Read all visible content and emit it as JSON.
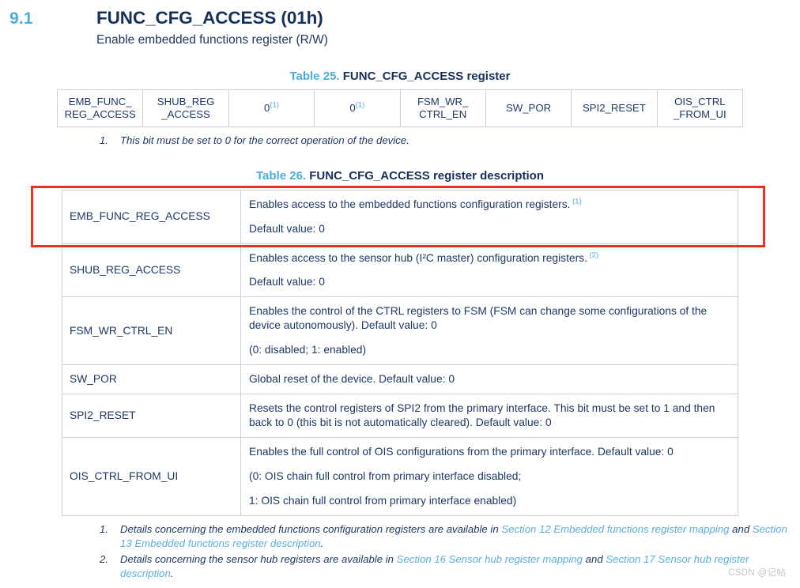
{
  "header": {
    "section_number": "9.1",
    "title": "FUNC_CFG_ACCESS (01h)",
    "subtitle": "Enable embedded functions register (R/W)"
  },
  "register_table": {
    "caption_number": "Table 25.",
    "caption_text": "FUNC_CFG_ACCESS register",
    "bits": [
      {
        "label": "EMB_FUNC_\nREG_ACCESS",
        "footnote": ""
      },
      {
        "label": "SHUB_REG\n_ACCESS",
        "footnote": ""
      },
      {
        "label": "0",
        "footnote": "(1)"
      },
      {
        "label": "0",
        "footnote": "(1)"
      },
      {
        "label": "FSM_WR_\nCTRL_EN",
        "footnote": ""
      },
      {
        "label": "SW_POR",
        "footnote": ""
      },
      {
        "label": "SPI2_RESET",
        "footnote": ""
      },
      {
        "label": "OIS_CTRL\n_FROM_UI",
        "footnote": ""
      }
    ],
    "footnotes": [
      {
        "marker": "1.",
        "text": "This bit must be set to 0 for the correct operation of the device."
      }
    ]
  },
  "description_table": {
    "caption_number": "Table 26.",
    "caption_text": "FUNC_CFG_ACCESS register description",
    "rows": [
      {
        "name": "EMB_FUNC_REG_ACCESS",
        "paragraphs": [
          "Enables access to the embedded functions configuration registers.",
          "Default value: 0"
        ],
        "footnote_ref": "(1)",
        "highlighted": true
      },
      {
        "name": "SHUB_REG_ACCESS",
        "paragraphs": [
          "Enables access to the sensor hub (I²C master) configuration registers.",
          "Default value: 0"
        ],
        "footnote_ref": "(2)",
        "highlighted": false
      },
      {
        "name": "FSM_WR_CTRL_EN",
        "paragraphs": [
          "Enables the control of the CTRL registers to FSM (FSM can change some configurations of the device autonomously). Default value: 0",
          "(0: disabled; 1: enabled)"
        ],
        "footnote_ref": "",
        "highlighted": false
      },
      {
        "name": "SW_POR",
        "paragraphs": [
          "Global reset of the device. Default value: 0"
        ],
        "footnote_ref": "",
        "highlighted": false
      },
      {
        "name": "SPI2_RESET",
        "paragraphs": [
          "Resets the control registers of SPI2 from the primary interface. This bit must be set to 1 and then back to 0 (this bit is not automatically cleared). Default value: 0"
        ],
        "footnote_ref": "",
        "highlighted": false
      },
      {
        "name": "OIS_CTRL_FROM_UI",
        "paragraphs": [
          "Enables the full control of OIS configurations from the primary interface. Default value: 0",
          "(0: OIS chain full control from primary interface disabled;",
          "1: OIS chain full control from primary interface enabled)"
        ],
        "footnote_ref": "",
        "highlighted": false
      }
    ],
    "footnotes": [
      {
        "marker": "1.",
        "segments": [
          {
            "text": "Details concerning the embedded functions configuration registers are available in ",
            "link": false
          },
          {
            "text": "Section 12 Embedded functions register mapping",
            "link": true
          },
          {
            "text": " and ",
            "link": false
          },
          {
            "text": "Section 13 Embedded functions register description",
            "link": true
          },
          {
            "text": ".",
            "link": false
          }
        ]
      },
      {
        "marker": "2.",
        "segments": [
          {
            "text": "Details concerning the sensor hub registers are available in ",
            "link": false
          },
          {
            "text": "Section 16 Sensor hub register mapping",
            "link": true
          },
          {
            "text": " and ",
            "link": false
          },
          {
            "text": "Section 17 Sensor hub register description",
            "link": true
          },
          {
            "text": ".",
            "link": false
          }
        ]
      }
    ]
  },
  "watermark": "CSDN @记帖"
}
